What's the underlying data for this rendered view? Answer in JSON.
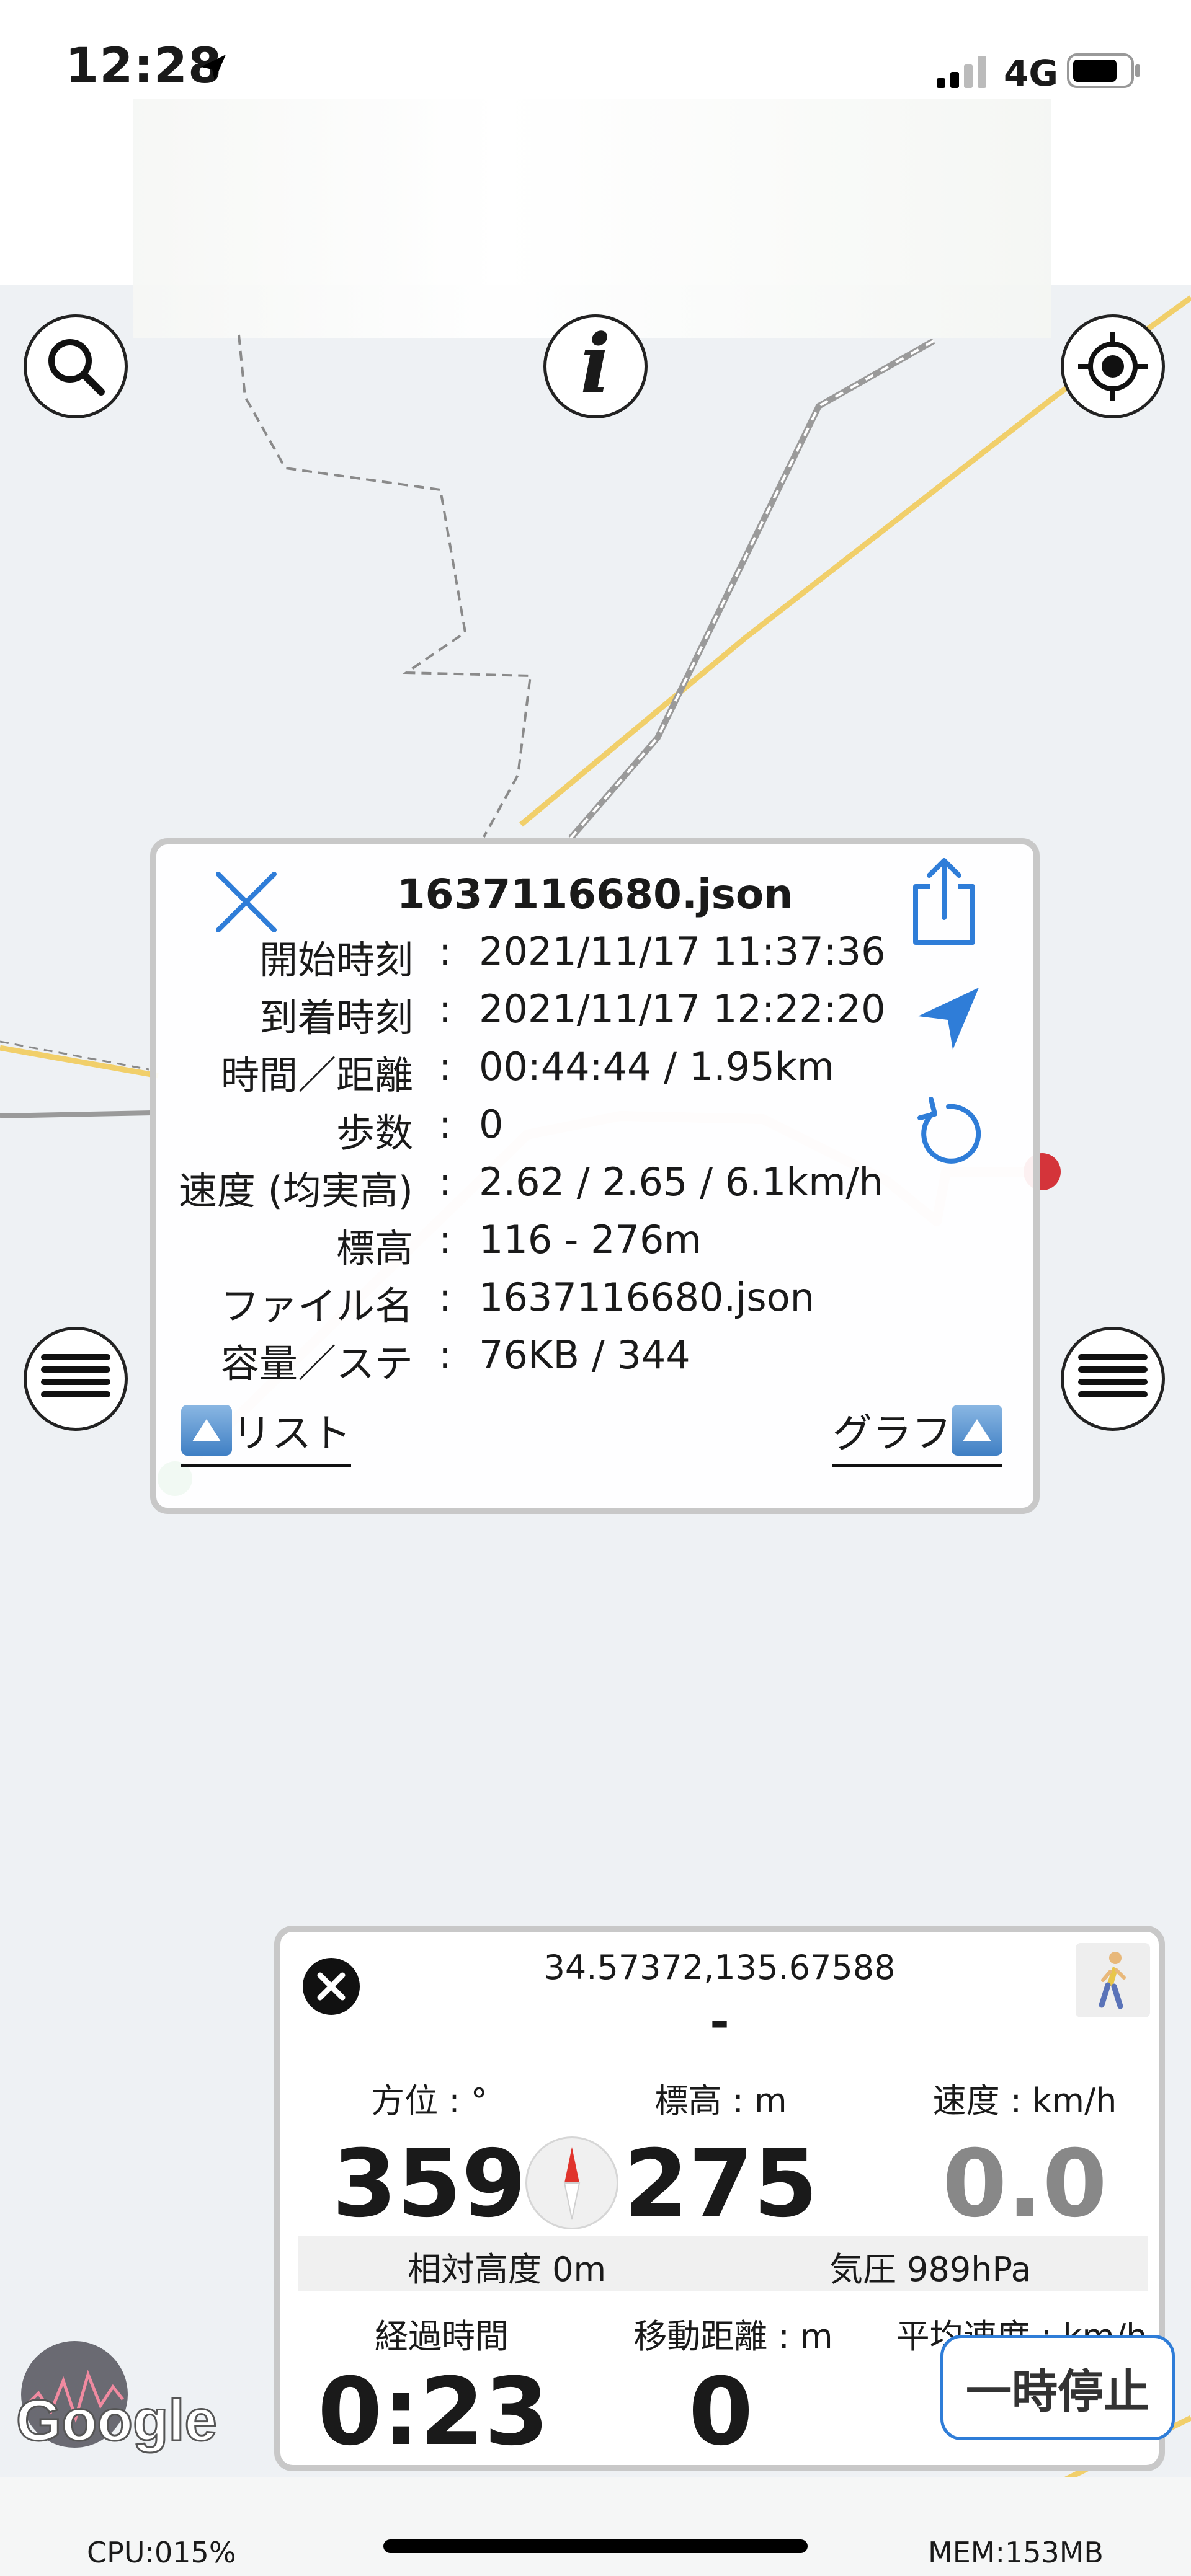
{
  "status_bar": {
    "time": "12:28",
    "network": "4G"
  },
  "track_popup": {
    "title": "1637116680.json",
    "rows": [
      {
        "label": "開始時刻",
        "value": "2021/11/17 11:37:36"
      },
      {
        "label": "到着時刻",
        "value": "2021/11/17 12:22:20"
      },
      {
        "label": "時間／距離",
        "value": "00:44:44 / 1.95km"
      },
      {
        "label": "歩数",
        "value": "0"
      },
      {
        "label": "速度 (均実高)",
        "value": "2.62 / 2.65 / 6.1km/h"
      },
      {
        "label": "標高",
        "value": "116 - 276m"
      },
      {
        "label": "ファイル名",
        "value": "1637116680.json"
      },
      {
        "label": "容量／ステ",
        "value": "76KB / 344"
      }
    ],
    "colon": ":",
    "list_link": "リスト",
    "graph_link": "グラフ"
  },
  "sensor_panel": {
    "coordinates": "34.57372,135.67588",
    "address": "-",
    "heading_label": "方位 : °",
    "heading_value": "359",
    "altitude_label": "標高 : m",
    "altitude_value": "275",
    "speed_label": "速度 : km/h",
    "speed_value": "0.0",
    "relative_altitude": "相対高度 0m",
    "pressure": "気圧 989hPa",
    "elapsed_label": "経過時間",
    "elapsed_value": "0:23",
    "distance_label": "移動距離 : m",
    "distance_value": "0",
    "avg_speed_label": "平均速度 : km/h",
    "pause_label": "一時停止"
  },
  "map": {
    "attribution": "Google",
    "route_color": "#f2d4d4",
    "road_color": "#f3d57a"
  },
  "footer": {
    "cpu": "CPU:015%",
    "mem": "MEM:153MB"
  },
  "icons": {
    "search": "search-icon",
    "info": "info-icon",
    "locate": "locate-icon",
    "menu": "hamburger-icon",
    "close": "close-icon",
    "share": "share-icon",
    "navigate": "navigation-arrow-icon",
    "reload": "reload-icon",
    "walker": "walker-icon"
  }
}
